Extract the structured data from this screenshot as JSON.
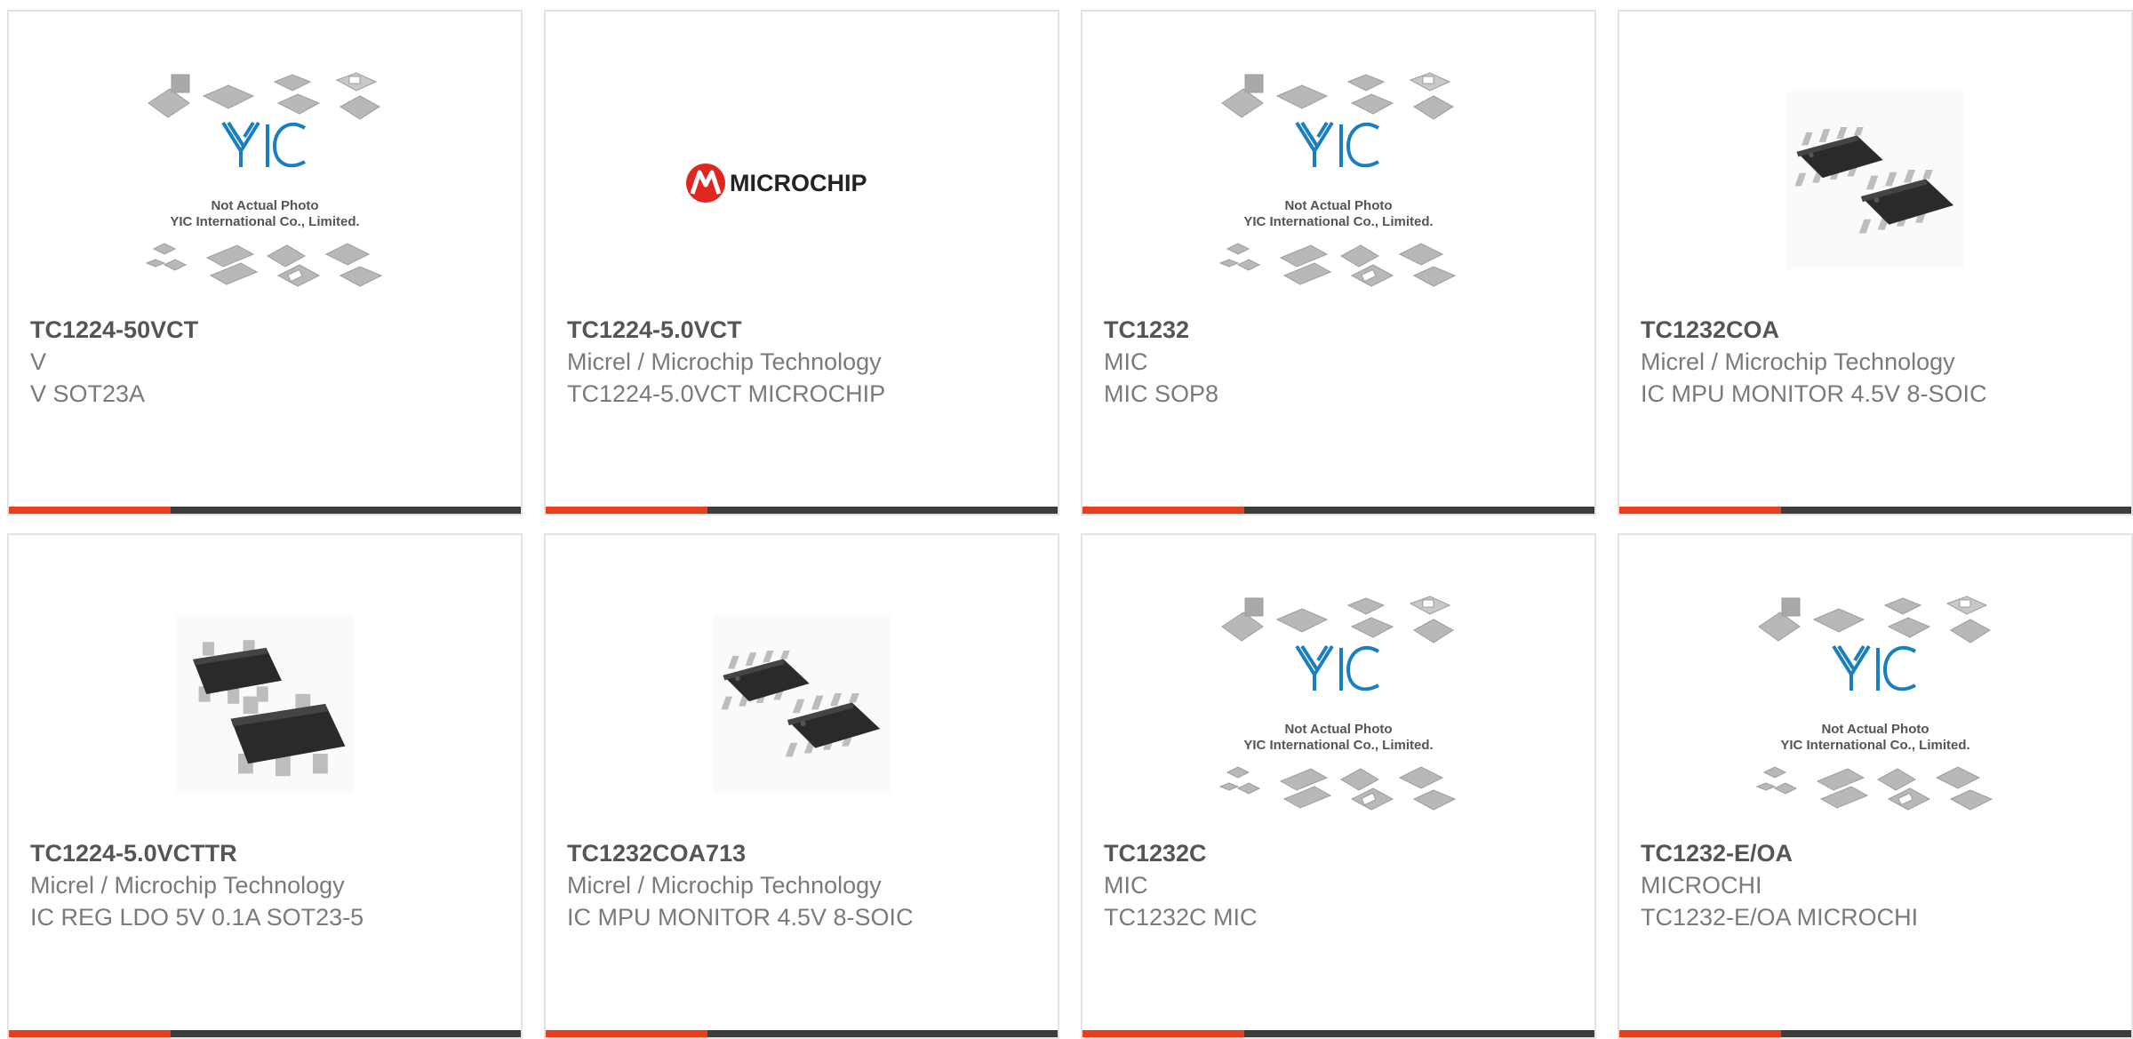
{
  "products": [
    {
      "part_number": "TC1224-50VCT",
      "manufacturer": "V",
      "description": "V SOT23A",
      "image": "not-actual-photo"
    },
    {
      "part_number": "TC1224-5.0VCT",
      "manufacturer": "Micrel / Microchip Technology",
      "description": "TC1224-5.0VCT MICROCHIP",
      "image": "microchip-logo"
    },
    {
      "part_number": "TC1232",
      "manufacturer": "MIC",
      "description": "MIC SOP8",
      "image": "not-actual-photo"
    },
    {
      "part_number": "TC1232COA",
      "manufacturer": "Micrel / Microchip Technology",
      "description": "IC MPU MONITOR 4.5V 8-SOIC",
      "image": "soic-8-chips"
    },
    {
      "part_number": "TC1224-5.0VCTTR",
      "manufacturer": "Micrel / Microchip Technology",
      "description": "IC REG LDO 5V 0.1A SOT23-5",
      "image": "sot23-5-chips"
    },
    {
      "part_number": "TC1232COA713",
      "manufacturer": "Micrel / Microchip Technology",
      "description": "IC MPU MONITOR 4.5V 8-SOIC",
      "image": "soic-8-chips"
    },
    {
      "part_number": "TC1232C",
      "manufacturer": "MIC",
      "description": "TC1232C MIC",
      "image": "not-actual-photo"
    },
    {
      "part_number": "TC1232-E/OA",
      "manufacturer": "MICROCHI",
      "description": "TC1232-E/OA MICROCHI",
      "image": "not-actual-photo"
    }
  ],
  "placeholder": {
    "logo_text": "YIC",
    "line1": "Not Actual Photo",
    "line2": "YIC International Co., Limited."
  },
  "brand_logo_text": "MICROCHIP",
  "colors": {
    "accent": "#e8401c",
    "bar": "#3d3d3d",
    "part_number": "#555555",
    "secondary_text": "#7a7a7a",
    "card_border": "#e3e3e3",
    "yic_logo": "#1a7fc1",
    "microchip_red": "#e0261f"
  }
}
